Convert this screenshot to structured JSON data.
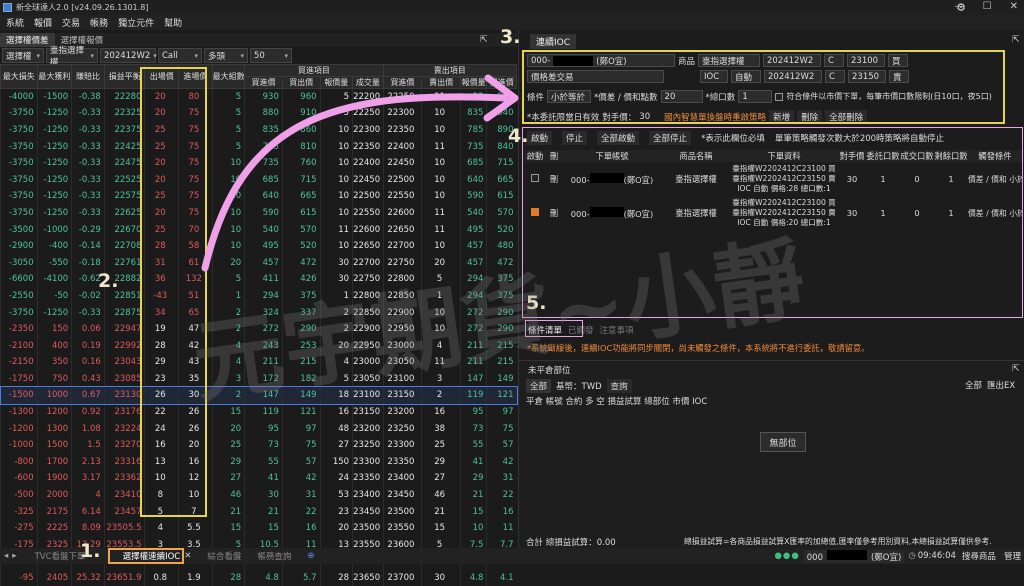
{
  "window": {
    "title": "新全球達人2.0 [v24.09.26.1301.8]"
  },
  "menu": [
    "系統",
    "報價",
    "交易",
    "帳務",
    "獨立元件",
    "幫助"
  ],
  "left": {
    "tabs": [
      "選擇權價差",
      "選擇權報價"
    ],
    "selects": [
      "選擇權",
      "臺指選擇權",
      "202412W2",
      "Call",
      "多頭",
      "50"
    ],
    "headers": [
      "最大損失",
      "最大獲利",
      "賺賠比",
      "損益平衡",
      "出場價",
      "進場價",
      "最大組數",
      "買進價",
      "買出價",
      "報價量",
      "成交量",
      "買進價",
      "賣出價",
      "報價量",
      "買進價"
    ],
    "group_headers": [
      "買進項目",
      "賣出項目"
    ],
    "rows": [
      [
        "-4000",
        "-1500",
        "-0.38",
        "22280",
        "20",
        "80",
        "5",
        "930",
        "960",
        "5",
        "22200",
        "22250",
        "11",
        "23",
        "990"
      ],
      [
        "-3750",
        "-1250",
        "-0.33",
        "22325",
        "20",
        "75",
        "5",
        "880",
        "910",
        "5",
        "22250",
        "22300",
        "10",
        "835",
        "940"
      ],
      [
        "-3750",
        "-1250",
        "-0.33",
        "22375",
        "25",
        "75",
        "5",
        "835",
        "860",
        "10",
        "22300",
        "22350",
        "10",
        "785",
        "890"
      ],
      [
        "-3750",
        "-1250",
        "-0.33",
        "22425",
        "25",
        "75",
        "5",
        "785",
        "810",
        "10",
        "22350",
        "22400",
        "11",
        "735",
        "840"
      ],
      [
        "-3750",
        "-1250",
        "-0.33",
        "22475",
        "20",
        "75",
        "10",
        "735",
        "760",
        "10",
        "22400",
        "22450",
        "10",
        "685",
        "715"
      ],
      [
        "-3750",
        "-1250",
        "-0.33",
        "22525",
        "20",
        "75",
        "10",
        "685",
        "715",
        "10",
        "22450",
        "22500",
        "10",
        "640",
        "665"
      ],
      [
        "-3750",
        "-1250",
        "-0.33",
        "22575",
        "25",
        "75",
        "10",
        "640",
        "665",
        "10",
        "22500",
        "22550",
        "10",
        "590",
        "615"
      ],
      [
        "-3750",
        "-1250",
        "-0.33",
        "22625",
        "20",
        "75",
        "10",
        "590",
        "615",
        "10",
        "22550",
        "22600",
        "11",
        "540",
        "570"
      ],
      [
        "-3500",
        "-1000",
        "-0.29",
        "22670",
        "25",
        "70",
        "10",
        "540",
        "570",
        "11",
        "22600",
        "22650",
        "11",
        "495",
        "520"
      ],
      [
        "-2900",
        "-400",
        "-0.14",
        "22708",
        "28",
        "58",
        "10",
        "495",
        "520",
        "10",
        "22650",
        "22700",
        "10",
        "457",
        "480"
      ],
      [
        "-3050",
        "-550",
        "-0.18",
        "22761",
        "31",
        "61",
        "20",
        "457",
        "472",
        "30",
        "22700",
        "22750",
        "20",
        "457",
        "472"
      ],
      [
        "-6600",
        "-4100",
        "-0.62",
        "22882",
        "36",
        "132",
        "5",
        "411",
        "426",
        "30",
        "22750",
        "22800",
        "5",
        "294",
        "375"
      ],
      [
        "-2550",
        "-50",
        "-0.02",
        "22851",
        "-43",
        "51",
        "1",
        "294",
        "375",
        "1",
        "22800",
        "22850",
        "1",
        "294",
        "375"
      ],
      [
        "-3750",
        "-1250",
        "-0.33",
        "22875",
        "34",
        "65",
        "2",
        "324",
        "337",
        "2",
        "22850",
        "22900",
        "10",
        "272",
        "290"
      ],
      [
        "-2350",
        "150",
        "0.06",
        "22947",
        "19",
        "47",
        "2",
        "272",
        "290",
        "2",
        "22900",
        "22950",
        "10",
        "272",
        "290"
      ],
      [
        "-2100",
        "400",
        "0.19",
        "22992",
        "28",
        "42",
        "4",
        "243",
        "253",
        "20",
        "22950",
        "23000",
        "4",
        "211",
        "215"
      ],
      [
        "-2150",
        "350",
        "0.16",
        "23043",
        "29",
        "43",
        "4",
        "211",
        "215",
        "4",
        "23000",
        "23050",
        "11",
        "211",
        "215"
      ],
      [
        "-1750",
        "750",
        "0.43",
        "23085",
        "23",
        "35",
        "3",
        "172",
        "182",
        "5",
        "23050",
        "23100",
        "3",
        "147",
        "149"
      ],
      [
        "-1500",
        "1000",
        "0.67",
        "23130",
        "26",
        "30",
        "2",
        "147",
        "149",
        "18",
        "23100",
        "23150",
        "2",
        "119",
        "121"
      ],
      [
        "-1300",
        "1200",
        "0.92",
        "23176",
        "22",
        "26",
        "15",
        "119",
        "121",
        "16",
        "23150",
        "23200",
        "16",
        "95",
        "97"
      ],
      [
        "-1200",
        "1300",
        "1.08",
        "23224",
        "24",
        "26",
        "20",
        "95",
        "97",
        "48",
        "23200",
        "23250",
        "38",
        "73",
        "75"
      ],
      [
        "-1000",
        "1500",
        "1.5",
        "23270",
        "16",
        "20",
        "25",
        "73",
        "75",
        "27",
        "23250",
        "23300",
        "25",
        "55",
        "57"
      ],
      [
        "-800",
        "1700",
        "2.13",
        "23316",
        "13",
        "16",
        "29",
        "55",
        "57",
        "150",
        "23300",
        "23350",
        "29",
        "41",
        "42"
      ],
      [
        "-600",
        "1900",
        "3.17",
        "23362",
        "10",
        "12",
        "27",
        "41",
        "42",
        "24",
        "23350",
        "23400",
        "27",
        "29",
        "31"
      ],
      [
        "-500",
        "2000",
        "4",
        "23410",
        "8",
        "10",
        "46",
        "30",
        "31",
        "53",
        "23400",
        "23450",
        "46",
        "21",
        "22"
      ],
      [
        "-325",
        "2175",
        "6.14",
        "23457",
        "5",
        "7",
        "21",
        "21",
        "22",
        "23",
        "23450",
        "23500",
        "21",
        "15",
        "16"
      ],
      [
        "-275",
        "2225",
        "8.09",
        "23505.5",
        "4",
        "5.5",
        "15",
        "15",
        "16",
        "20",
        "23500",
        "23550",
        "15",
        "10",
        "11"
      ],
      [
        "-175",
        "2325",
        "13.29",
        "23553.5",
        "3",
        "3.5",
        "5",
        "10.5",
        "11",
        "13",
        "23550",
        "23600",
        "5",
        "7.5",
        "7.7"
      ],
      [
        "-140",
        "2360",
        "16.86",
        "23602.8",
        "1.8",
        "1.8",
        "1",
        "7.5",
        "7.7",
        "1",
        "23600",
        "23650",
        "29",
        "4.9",
        "5.7"
      ],
      [
        "-95",
        "2405",
        "25.32",
        "23651.9",
        "0.8",
        "1.9",
        "28",
        "4.8",
        "5.7",
        "28",
        "23650",
        "23700",
        "30",
        "4.8",
        "4.1"
      ]
    ]
  },
  "right": {
    "tab": "連續IOC",
    "form": {
      "account": "000-",
      "account_name": "(鄭O宜)",
      "product_label": "商品",
      "product": "臺指選擇權",
      "month1": "202412W2",
      "cp1": "C",
      "strike1": "23100",
      "side1": "買",
      "strategy": "價格差交易",
      "ioc": "IOC",
      "auto": "自動",
      "month2": "202412W2",
      "cp2": "C",
      "strike2": "23150",
      "side2": "賣",
      "cond_label": "條件",
      "cond": "小於等於",
      "price_label": "*價差 / 價和點數",
      "price": "20",
      "qty_label": "*總口數",
      "qty": "1",
      "market_check": "符合條件以市價下單，每筆市價口數限制(日10口，夜5口)",
      "note1": "*本委託限當日有效",
      "note2": "對手價：",
      "note3": "30",
      "smart": "國內智慧單換盤時重啟策略",
      "add": "新增",
      "del": "刪除",
      "delall": "全部刪除"
    },
    "actions": [
      "啟動",
      "停止",
      "全部啟動",
      "全部停止",
      "*表示此欄位必填",
      "單筆策略觸發次數大於200時策略將自動停止"
    ],
    "order_headers": [
      "啟動",
      "刪",
      "下單帳號",
      "商品名稱",
      "下單資料",
      "對手價",
      "委託口數",
      "成交口數",
      "剩餘口數",
      "觸發條件"
    ],
    "orders": [
      {
        "acct": "000-",
        "name": "(鄭O宜)",
        "product": "臺指選擇權",
        "data1": "臺指權W2202412C23100 買",
        "data2": "臺指權W2202412C23150 賣",
        "data3": "IOC 自動 價格:28 總口數:1",
        "opp": "30",
        "qty": "1",
        "filled": "0",
        "remain": "1",
        "cond": "價差 / 價和 小於等於 2",
        "checked": false
      },
      {
        "acct": "000-",
        "name": "(鄭O宜)",
        "product": "臺指選擇權",
        "data1": "臺指權W2202412C23100 買",
        "data2": "臺指權W2202412C23150 賣",
        "data3": "IOC 自動 價格:20 總口數:1",
        "opp": "30",
        "qty": "1",
        "filled": "0",
        "remain": "1",
        "cond": "價差 / 價和 小於等於 2",
        "checked": true
      }
    ],
    "subtabs": [
      "條件清單",
      "已觸發",
      "注意事項"
    ],
    "warning": "*系統斷線後，連續IOC功能將同步關閉，尚未觸發之條件，本系統將不進行委託，敬請留意。",
    "positions": {
      "title": "未平倉部位",
      "all": "全部",
      "base": "基幣：TWD",
      "query": "查詢",
      "filter": "全部",
      "export": "匯出EX",
      "cols": "平倉  帳號  合約  多  空  損益試算  總部位  市價  IOC",
      "empty": "無部位",
      "total": "合計  總損益試算：0.00",
      "footnote": "總損益試算=各商品損益試算X匯率的加總值,匯率僅參考用別資料,本總損益試算僅供參考."
    }
  },
  "bottom": {
    "tabs": [
      "TVC看盤下單",
      "選擇權連續IOC",
      "綜合看盤",
      "帳務查詢"
    ],
    "status_acct": "000",
    "status_name": "(鄭O宜)",
    "time": "09:46:04",
    "search": "搜尋商品",
    "manage": "管理"
  },
  "annotations": {
    "n1": "1.",
    "n2": "2.",
    "n3": "3.",
    "n4": "4.",
    "n5": "5.",
    "watermark": "元宇期貨~小靜"
  },
  "colors": {
    "green": "#4fc29a",
    "red": "#e05a5a",
    "yellow_box": "#e6d54a",
    "pink_arrow": "#f0a0e8",
    "orange": "#f08a3a"
  }
}
